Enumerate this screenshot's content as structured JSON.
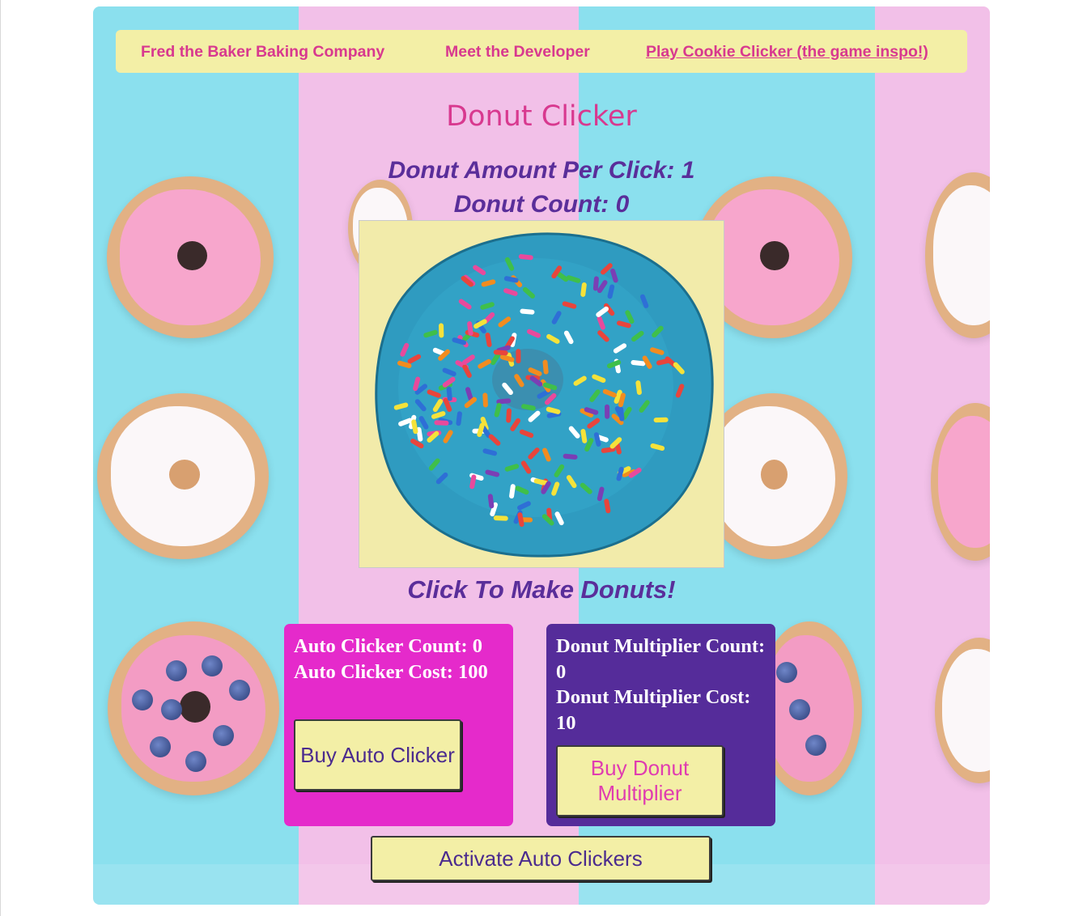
{
  "nav": {
    "company": "Fred the Baker Baking Company",
    "developer": "Meet the Developer",
    "cookie_clicker": "Play Cookie Clicker (the game inspo!)"
  },
  "title": "Donut Clicker",
  "stats": {
    "per_click": "Donut Amount Per Click: 1",
    "count": "Donut Count: 0"
  },
  "cta": "Click To Make Donuts!",
  "auto_clicker": {
    "count": "Auto Clicker Count: 0",
    "cost": "Auto Clicker Cost: 100",
    "button": "Buy Auto Clicker"
  },
  "multiplier": {
    "count": "Donut Multiplier Count: 0",
    "cost": "Donut Multiplier Cost: 10",
    "button": "Buy Donut Multiplier"
  },
  "activate_button": "Activate Auto Clickers",
  "colors": {
    "accent_pink": "#d8398f",
    "accent_purple": "#5a2e9a",
    "panel_magenta": "#e52acb",
    "panel_purple": "#552c9a",
    "nav_yellow": "#f3efa6"
  },
  "icons": {
    "main_image": "blue-sprinkle-donut-image"
  }
}
